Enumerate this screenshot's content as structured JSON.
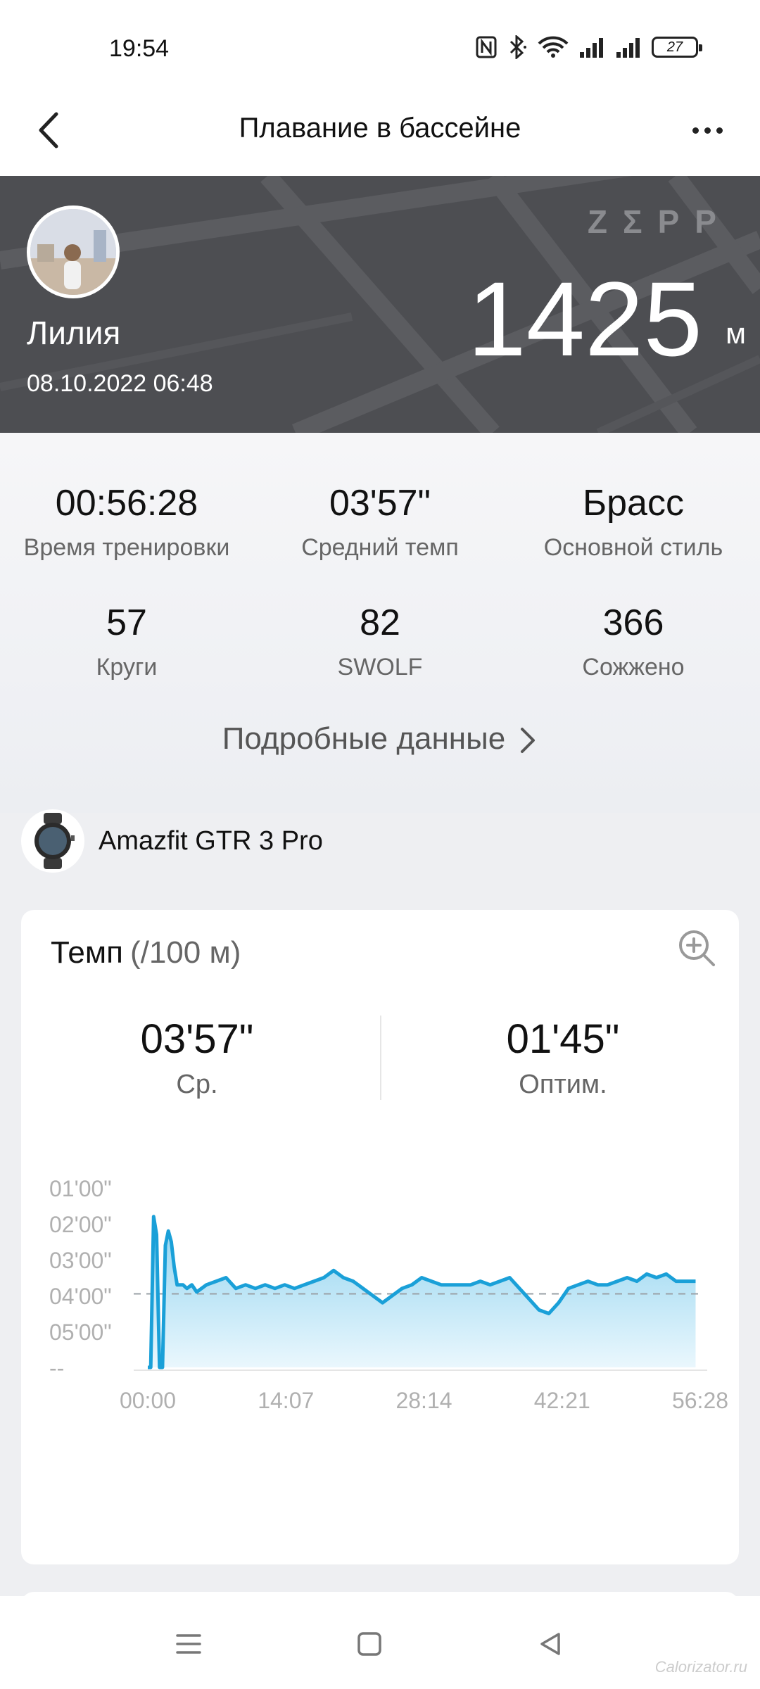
{
  "status_bar": {
    "time": "19:54",
    "battery": "27",
    "icons": [
      "nfc-icon",
      "bluetooth-icon",
      "wifi-icon",
      "signal-icon",
      "signal-icon",
      "battery-icon"
    ]
  },
  "nav": {
    "title": "Плавание в бассейне",
    "back_icon": "chevron-left-icon",
    "more_icon": "more-dots-icon"
  },
  "hero": {
    "user_name": "Лилия",
    "date": "08.10.2022 06:48",
    "brand": "ZΣPP",
    "distance": "1425",
    "distance_unit": "м"
  },
  "stats": [
    {
      "value": "00:56:28",
      "label": "Время тренировки"
    },
    {
      "value": "03'57\"",
      "label": "Средний темп"
    },
    {
      "value": "Брасс",
      "label": "Основной стиль"
    },
    {
      "value": "57",
      "label": "Круги"
    },
    {
      "value": "82",
      "label": "SWOLF"
    },
    {
      "value": "366",
      "label": "Сожжено"
    }
  ],
  "details_link": "Подробные данные",
  "device": {
    "name": "Amazfit GTR 3 Pro"
  },
  "pace_card": {
    "title": "Темп",
    "unit": "(/100 м)",
    "avg_value": "03'57\"",
    "avg_label": "Ср.",
    "best_value": "01'45\"",
    "best_label": "Оптим."
  },
  "chart_data": {
    "type": "area",
    "title": "Темп",
    "y_unit": "(/100 м)",
    "y_tick_labels": [
      "01'00\"",
      "02'00\"",
      "03'00\"",
      "04'00\"",
      "05'00\"",
      "--"
    ],
    "x_tick_labels": [
      "00:00",
      "14:07",
      "28:14",
      "42:21",
      "56:28"
    ],
    "y_axis_inverted": true,
    "y_range_minutes": [
      1,
      6
    ],
    "average_line_minutes": 3.95,
    "x_minutes": [
      0,
      0.3,
      0.6,
      0.9,
      1.2,
      1.5,
      1.8,
      2.1,
      2.4,
      2.7,
      3.0,
      3.3,
      3.6,
      4.0,
      4.5,
      5.0,
      6,
      7,
      8,
      9,
      10,
      11,
      12,
      13,
      14,
      15,
      16,
      17,
      18,
      19,
      20,
      21,
      22,
      23,
      24,
      25,
      26,
      27,
      28,
      29,
      30,
      31,
      32,
      33,
      34,
      35,
      36,
      37,
      38,
      39,
      40,
      41,
      42,
      43,
      44,
      45,
      46,
      47,
      48,
      49,
      50,
      51,
      52,
      53,
      54,
      55,
      56
    ],
    "pace_minutes": [
      6.0,
      6.0,
      1.8,
      2.3,
      6.0,
      6.0,
      2.6,
      2.2,
      2.5,
      3.2,
      3.7,
      3.7,
      3.7,
      3.8,
      3.7,
      3.9,
      3.7,
      3.6,
      3.5,
      3.8,
      3.7,
      3.8,
      3.7,
      3.8,
      3.7,
      3.8,
      3.7,
      3.6,
      3.5,
      3.3,
      3.5,
      3.6,
      3.8,
      4.0,
      4.2,
      4.0,
      3.8,
      3.7,
      3.5,
      3.6,
      3.7,
      3.7,
      3.7,
      3.7,
      3.6,
      3.7,
      3.6,
      3.5,
      3.8,
      4.1,
      4.4,
      4.5,
      4.2,
      3.8,
      3.7,
      3.6,
      3.7,
      3.7,
      3.6,
      3.5,
      3.6,
      3.4,
      3.5,
      3.4,
      3.6,
      3.6,
      3.6
    ],
    "colors": {
      "line": "#1aa0d8",
      "fill_top": "#8fd3ef",
      "fill_bottom": "#eaf7fd",
      "avg_line": "#9aa0a6"
    }
  },
  "system_nav": [
    "menu-icon",
    "home-icon",
    "back-triangle-icon"
  ],
  "watermark": "Calorizator.ru"
}
